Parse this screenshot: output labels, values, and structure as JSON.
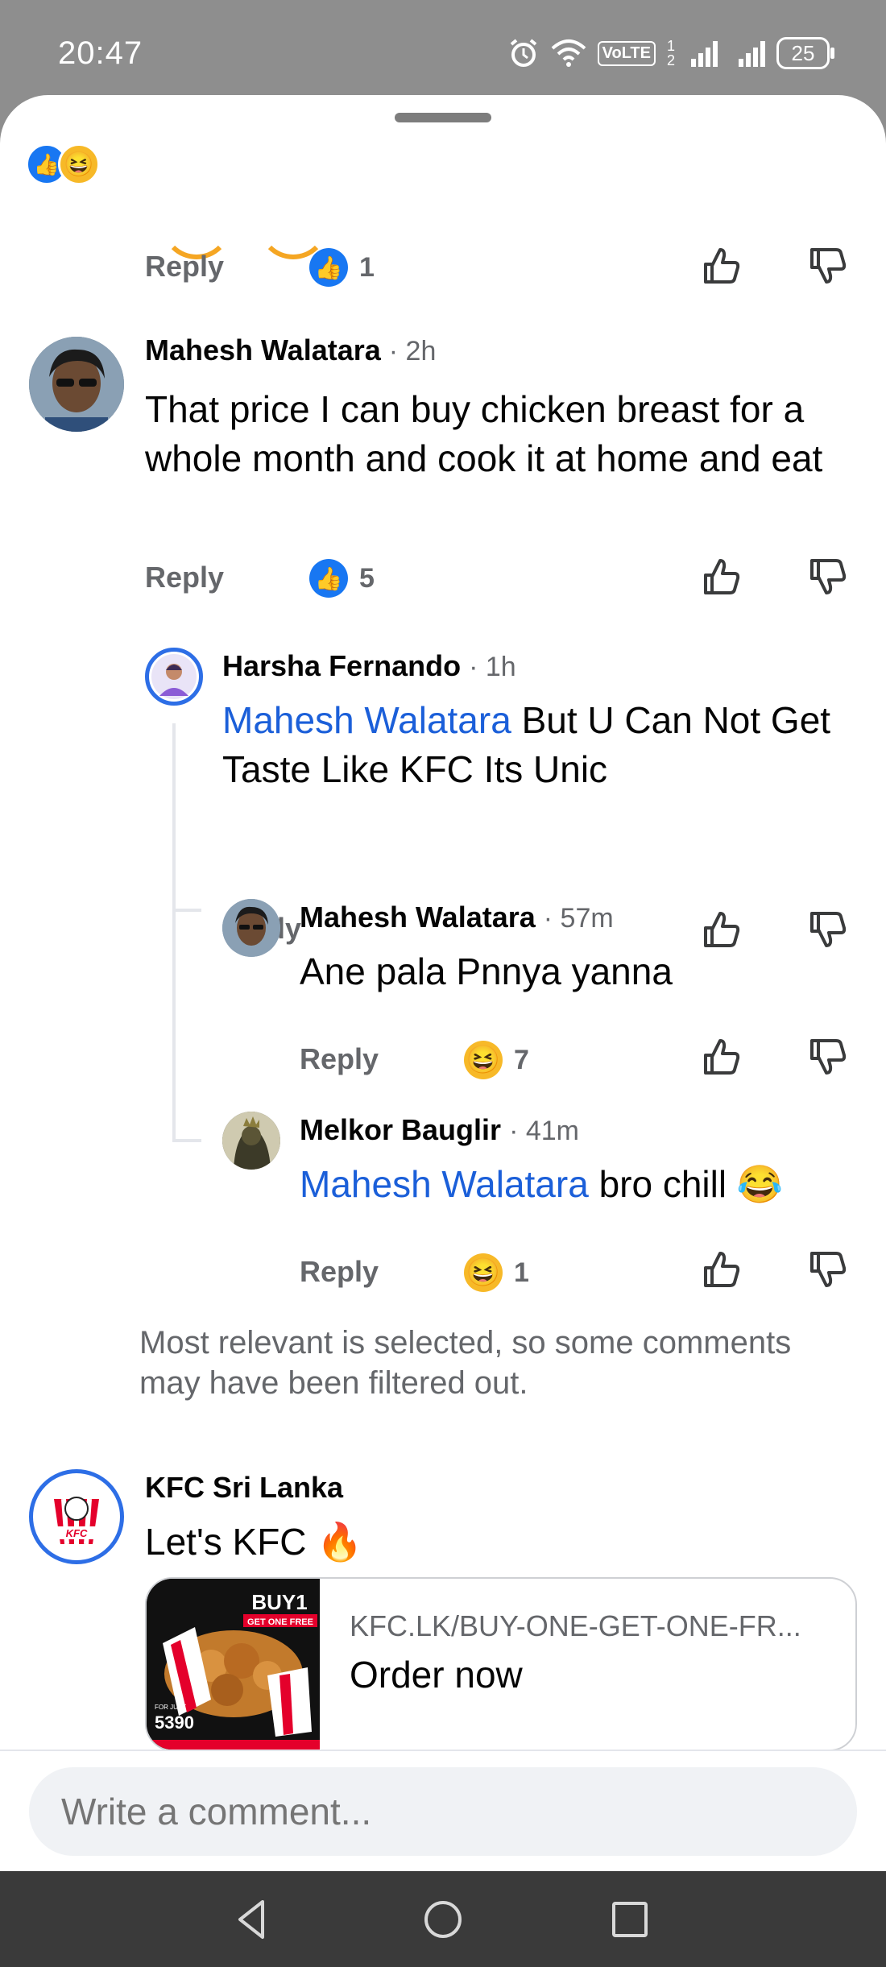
{
  "status_bar": {
    "time": "20:47",
    "network": "VoLTE",
    "sim": "1 2",
    "battery": "25",
    "icons": [
      "alarm-icon",
      "wifi-icon",
      "signal-icon",
      "signal-icon",
      "battery-icon"
    ]
  },
  "reaction_summary": {
    "icons": [
      "like-icon",
      "haha-icon"
    ],
    "like_glyph": "👍",
    "haha_glyph": "😆"
  },
  "colors": {
    "like": "#1877f2",
    "haha": "#f7b928",
    "mention": "#1b5fd9",
    "meta": "#65676b"
  },
  "comments": [
    {
      "reply_label": "Reply",
      "reaction_icon": "like-icon",
      "reaction_count": "1"
    },
    {
      "author": "Mahesh Walatara",
      "time": "· 2h",
      "text": "That price I can buy chicken breast for a whole month and cook it at home and eat",
      "reply_label": "Reply",
      "reaction_icon": "like-icon",
      "reaction_count": "5",
      "replies": [
        {
          "author": "Harsha Fernando",
          "time": "· 1h",
          "mention": "Mahesh Walatara",
          "text": " But U Can Not Get Taste Like KFC Its Unic",
          "reply_label": "Reply"
        },
        {
          "author": "Mahesh Walatara",
          "time": "· 57m",
          "text": "Ane pala Pnnya yanna",
          "reply_label": "Reply",
          "reaction_icon": "haha-icon",
          "reaction_count": "7"
        },
        {
          "author": "Melkor Bauglir",
          "time": "· 41m",
          "mention": "Mahesh Walatara",
          "text": " bro chill ",
          "emoji": "😂",
          "reply_label": "Reply",
          "reaction_icon": "haha-icon",
          "reaction_count": "1"
        }
      ]
    },
    {
      "author": "KFC Sri Lanka",
      "text": "Let's KFC ",
      "emoji": "🔥",
      "avatar_label": "KFC",
      "link": {
        "domain": "KFC.LK/BUY-ONE-GET-ONE-FR...",
        "title": "Order now",
        "thumb_text_1": "BUY1",
        "thumb_text_2": "GET ONE FREE",
        "thumb_text_3": "FOR JUST",
        "thumb_price": "5390"
      }
    }
  ],
  "filter_notice": "Most relevant is selected, so some comments may have been filtered out.",
  "composer": {
    "placeholder": "Write a comment..."
  },
  "nav_bar": {
    "icons": [
      "back-icon",
      "home-icon",
      "recents-icon"
    ]
  }
}
